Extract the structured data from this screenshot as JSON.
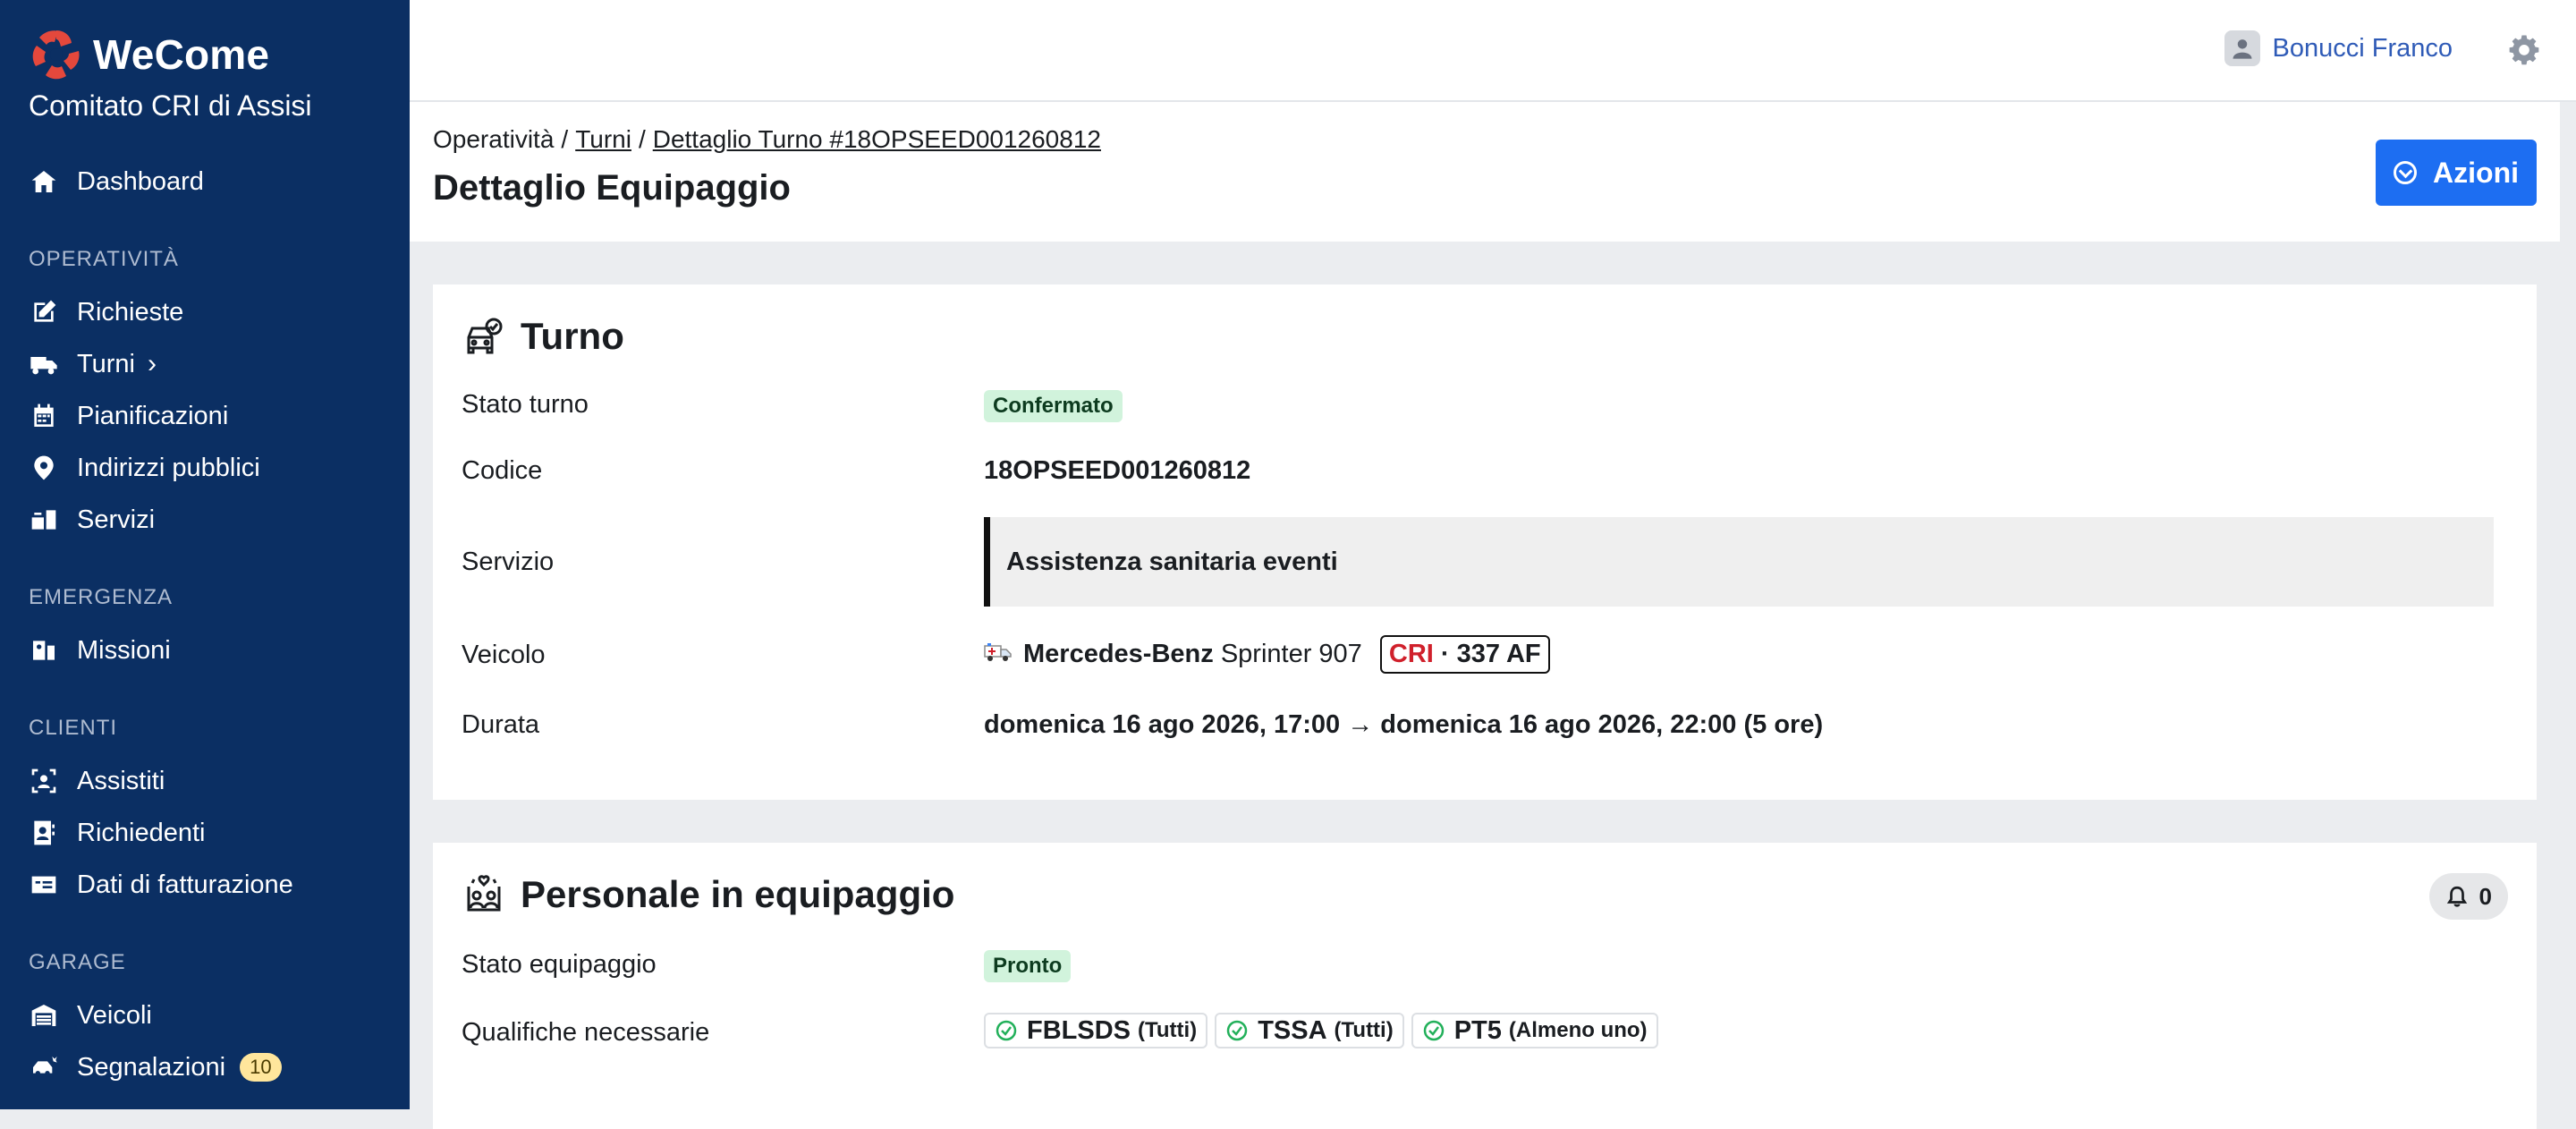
{
  "brand": {
    "name": "WeCome",
    "org": "Comitato CRI di Assisi",
    "accent": "#e4483c"
  },
  "sidebar": {
    "dashboard": "Dashboard",
    "sections": {
      "operativita": "OPERATIVITÀ",
      "emergenza": "EMERGENZA",
      "clienti": "CLIENTI",
      "garage": "GARAGE"
    },
    "items": {
      "richieste": "Richieste",
      "turni": "Turni",
      "pianificazioni": "Pianificazioni",
      "indirizzi": "Indirizzi pubblici",
      "servizi": "Servizi",
      "missioni": "Missioni",
      "assistiti": "Assistiti",
      "richiedenti": "Richiedenti",
      "fatturazione": "Dati di fatturazione",
      "veicoli": "Veicoli",
      "segnalazioni": "Segnalazioni",
      "segnalazioni_count": "10"
    },
    "bg_color": "#0b2f63"
  },
  "topbar": {
    "user_name": "Bonucci Franco"
  },
  "header": {
    "crumb_root": "Operatività",
    "crumb_turni": "Turni",
    "crumb_detail": "Dettaglio Turno #18OPSEED001260812",
    "title": "Dettaglio Equipaggio",
    "actions_label": "Azioni"
  },
  "turno": {
    "title": "Turno",
    "labels": {
      "stato": "Stato turno",
      "codice": "Codice",
      "servizio": "Servizio",
      "veicolo": "Veicolo",
      "durata": "Durata"
    },
    "stato": "Confermato",
    "codice": "18OPSEED001260812",
    "servizio": "Assistenza sanitaria eventi",
    "veicolo_brand": "Mercedes-Benz",
    "veicolo_model": "Sprinter 907",
    "plate_prefix": "CRI",
    "plate_rest": "· 337 AF",
    "durata": "domenica 16 ago 2026, 17:00 → domenica 16 ago 2026, 22:00 (5 ore)"
  },
  "equipaggio": {
    "title": "Personale in equipaggio",
    "notifications": "0",
    "labels": {
      "stato": "Stato equipaggio",
      "qualifiche": "Qualifiche necessarie"
    },
    "stato": "Pronto",
    "qualifiche": [
      {
        "code": "FBLSDS",
        "scope": "(Tutti)"
      },
      {
        "code": "TSSA",
        "scope": "(Tutti)"
      },
      {
        "code": "PT5",
        "scope": "(Almeno uno)"
      }
    ]
  }
}
